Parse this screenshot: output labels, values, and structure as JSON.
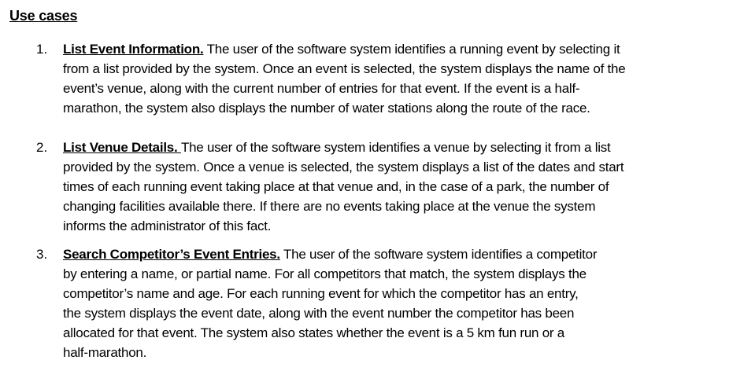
{
  "heading": "Use cases",
  "use_cases": [
    {
      "number": "1.",
      "title": "List Event Information.",
      "lines": [
        " The user of the software system identifies a running event by selecting it",
        "from a list provided by the system. Once an event is selected, the system displays the name of the",
        "event’s venue, along with the current number of entries for that event. If the event is a half-",
        "marathon, the system also displays the number of water stations along the route of the race."
      ]
    },
    {
      "number": "2.",
      "title": "List Venue Details. ",
      "lines": [
        "The user of the software system identifies a venue by selecting it from a list",
        "provided by the system. Once a venue is selected, the system displays a list of the dates and start",
        "times of each running event taking place at that venue and, in the case of a park, the number of",
        "changing facilities available there. If there are no events taking place at the venue the system",
        "informs the administrator of this fact."
      ]
    },
    {
      "number": "3.",
      "title": "Search Competitor’s Event Entries.",
      "lines": [
        " The user of the software system identifies a competitor",
        "by entering a name, or partial name. For all competitors that match, the system displays the",
        "competitor’s name and age. For each running event for which the competitor has an entry,",
        "the system displays the event date, along with the event number the competitor has been",
        "allocated for that event. The system also states whether the event is a 5 km fun run or a",
        "half-marathon."
      ]
    }
  ]
}
